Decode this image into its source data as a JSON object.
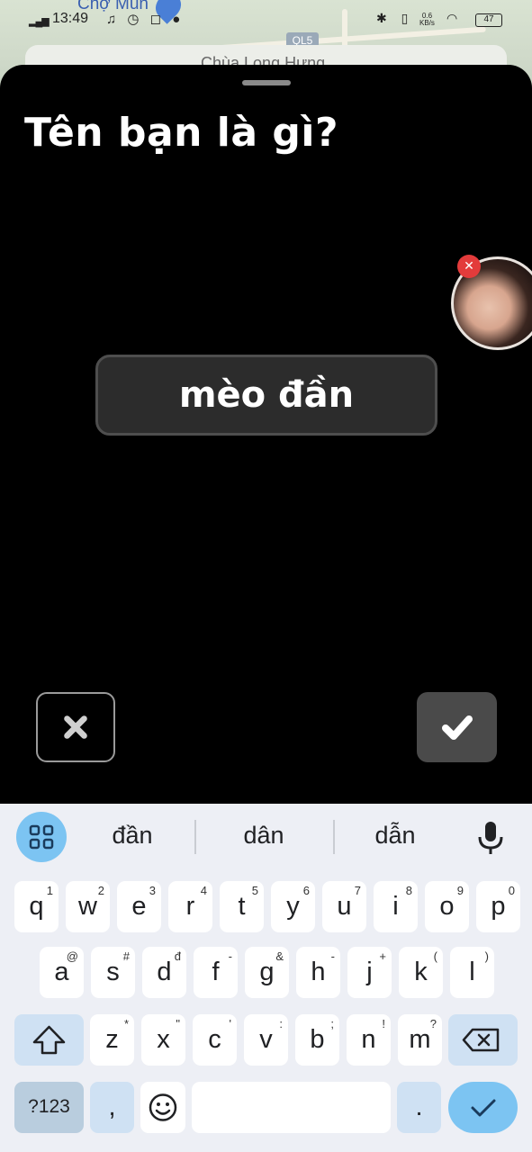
{
  "status_bar": {
    "time": "13:49",
    "signal": "▂▄▆",
    "left_icons": "♫ ◷ ◻ ●",
    "right_icons": "✱ ▯ ",
    "speed": "0.6\nKB/s",
    "battery": "47"
  },
  "map": {
    "place_label": "Chợ Mún",
    "route_label": "QL5",
    "search_text": "Chùa Long Hưng"
  },
  "sheet": {
    "title": "Tên bạn là gì?",
    "name_value": "mèo đần",
    "avatar_badge": "✕",
    "cancel_icon": "close-icon",
    "confirm_icon": "check-icon"
  },
  "keyboard": {
    "suggestions": [
      "đần",
      "dân",
      "dẫn"
    ],
    "row1": [
      {
        "k": "q",
        "s": "1"
      },
      {
        "k": "w",
        "s": "2"
      },
      {
        "k": "e",
        "s": "3"
      },
      {
        "k": "r",
        "s": "4"
      },
      {
        "k": "t",
        "s": "5"
      },
      {
        "k": "y",
        "s": "6"
      },
      {
        "k": "u",
        "s": "7"
      },
      {
        "k": "i",
        "s": "8"
      },
      {
        "k": "o",
        "s": "9"
      },
      {
        "k": "p",
        "s": "0"
      }
    ],
    "row2": [
      {
        "k": "a",
        "s": "@"
      },
      {
        "k": "s",
        "s": "#"
      },
      {
        "k": "d",
        "s": "đ"
      },
      {
        "k": "f",
        "s": "-"
      },
      {
        "k": "g",
        "s": "&"
      },
      {
        "k": "h",
        "s": "-"
      },
      {
        "k": "j",
        "s": "+"
      },
      {
        "k": "k",
        "s": "("
      },
      {
        "k": "l",
        "s": ")"
      }
    ],
    "row3": [
      {
        "k": "z",
        "s": "*"
      },
      {
        "k": "x",
        "s": "\""
      },
      {
        "k": "c",
        "s": "'"
      },
      {
        "k": "v",
        "s": ":"
      },
      {
        "k": "b",
        "s": ";"
      },
      {
        "k": "n",
        "s": "!"
      },
      {
        "k": "m",
        "s": "?"
      }
    ],
    "sym_label": "?123",
    "comma_label": ",",
    "period_label": "."
  },
  "colors": {
    "sheet_bg": "#000000",
    "name_box_bg": "#2c2c2c",
    "keyboard_bg": "#edeff5",
    "accent": "#7cc4f2"
  }
}
